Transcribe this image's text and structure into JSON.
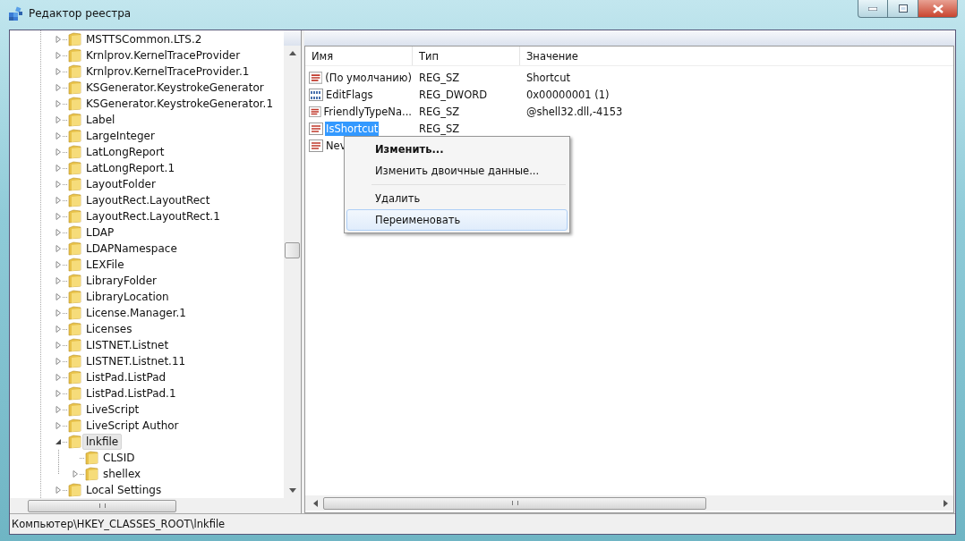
{
  "window": {
    "title": "Редактор реестра"
  },
  "tree": {
    "items": [
      {
        "label": "MSTTSCommon.LTS.2",
        "expandable": true,
        "expanded": false,
        "selected": false
      },
      {
        "label": "Krnlprov.KernelTraceProvider",
        "expandable": true,
        "expanded": false,
        "selected": false
      },
      {
        "label": "Krnlprov.KernelTraceProvider.1",
        "expandable": true,
        "expanded": false,
        "selected": false
      },
      {
        "label": "KSGenerator.KeystrokeGenerator",
        "expandable": true,
        "expanded": false,
        "selected": false
      },
      {
        "label": "KSGenerator.KeystrokeGenerator.1",
        "expandable": true,
        "expanded": false,
        "selected": false
      },
      {
        "label": "Label",
        "expandable": true,
        "expanded": false,
        "selected": false
      },
      {
        "label": "LargeInteger",
        "expandable": true,
        "expanded": false,
        "selected": false
      },
      {
        "label": "LatLongReport",
        "expandable": true,
        "expanded": false,
        "selected": false
      },
      {
        "label": "LatLongReport.1",
        "expandable": true,
        "expanded": false,
        "selected": false
      },
      {
        "label": "LayoutFolder",
        "expandable": true,
        "expanded": false,
        "selected": false
      },
      {
        "label": "LayoutRect.LayoutRect",
        "expandable": true,
        "expanded": false,
        "selected": false
      },
      {
        "label": "LayoutRect.LayoutRect.1",
        "expandable": true,
        "expanded": false,
        "selected": false
      },
      {
        "label": "LDAP",
        "expandable": true,
        "expanded": false,
        "selected": false
      },
      {
        "label": "LDAPNamespace",
        "expandable": true,
        "expanded": false,
        "selected": false
      },
      {
        "label": "LEXFile",
        "expandable": true,
        "expanded": false,
        "selected": false
      },
      {
        "label": "LibraryFolder",
        "expandable": true,
        "expanded": false,
        "selected": false
      },
      {
        "label": "LibraryLocation",
        "expandable": true,
        "expanded": false,
        "selected": false
      },
      {
        "label": "License.Manager.1",
        "expandable": true,
        "expanded": false,
        "selected": false
      },
      {
        "label": "Licenses",
        "expandable": true,
        "expanded": false,
        "selected": false
      },
      {
        "label": "LISTNET.Listnet",
        "expandable": true,
        "expanded": false,
        "selected": false
      },
      {
        "label": "LISTNET.Listnet.11",
        "expandable": true,
        "expanded": false,
        "selected": false
      },
      {
        "label": "ListPad.ListPad",
        "expandable": true,
        "expanded": false,
        "selected": false
      },
      {
        "label": "ListPad.ListPad.1",
        "expandable": true,
        "expanded": false,
        "selected": false
      },
      {
        "label": "LiveScript",
        "expandable": true,
        "expanded": false,
        "selected": false
      },
      {
        "label": "LiveScript Author",
        "expandable": true,
        "expanded": false,
        "selected": false
      },
      {
        "label": "lnkfile",
        "expandable": true,
        "expanded": true,
        "selected": true,
        "children": [
          {
            "label": "CLSID",
            "expandable": false,
            "selected": false
          },
          {
            "label": "shellex",
            "expandable": true,
            "expanded": false,
            "selected": false
          }
        ]
      },
      {
        "label": "Local Settings",
        "expandable": true,
        "expanded": false,
        "selected": false
      }
    ]
  },
  "values": {
    "columns": [
      "Имя",
      "Тип",
      "Значение"
    ],
    "rows": [
      {
        "kind": "string",
        "name": "(По умолчанию)",
        "type": "REG_SZ",
        "data": "Shortcut",
        "selected": false
      },
      {
        "kind": "dword",
        "name": "EditFlags",
        "type": "REG_DWORD",
        "data": "0x00000001 (1)",
        "selected": false
      },
      {
        "kind": "string",
        "name": "FriendlyTypeNa...",
        "type": "REG_SZ",
        "data": "@shell32.dll,-4153",
        "selected": false
      },
      {
        "kind": "string",
        "name": "IsShortcut",
        "type": "REG_SZ",
        "selected": true
      },
      {
        "kind": "string",
        "name": "Nev",
        "selected": false
      }
    ]
  },
  "context_menu": {
    "items": [
      {
        "kind": "item",
        "label": "Изменить...",
        "default": true,
        "selected": false
      },
      {
        "kind": "item",
        "label": "Изменить двоичные данные...",
        "default": false,
        "selected": false
      },
      {
        "kind": "separator"
      },
      {
        "kind": "item",
        "label": "Удалить",
        "default": false,
        "selected": false
      },
      {
        "kind": "item",
        "label": "Переименовать",
        "default": false,
        "selected": true
      }
    ]
  },
  "status_bar": {
    "path": "Компьютер\\HKEY_CLASSES_ROOT\\lnkfile"
  }
}
